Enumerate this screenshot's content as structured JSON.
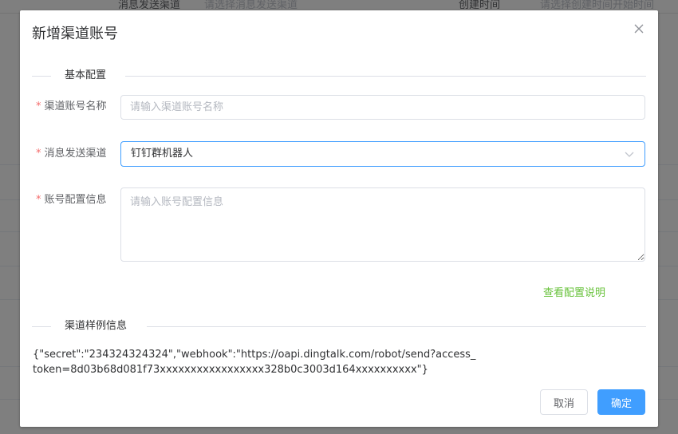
{
  "background": {
    "field1_label": "消息发送渠道",
    "field1_placeholder": "请选择消息发送渠道",
    "field2_label": "创建时间",
    "field2_placeholder": "请选择创建时间开始时间"
  },
  "dialog": {
    "title": "新增渠道账号",
    "close_icon": "close-icon",
    "section_basic": "基本配置",
    "section_sample": "渠道样例信息",
    "fields": {
      "account_name": {
        "label": "渠道账号名称",
        "placeholder": "请输入渠道账号名称",
        "value": ""
      },
      "channel": {
        "label": "消息发送渠道",
        "value": "钉钉群机器人"
      },
      "account_config": {
        "label": "账号配置信息",
        "placeholder": "请输入账号配置信息",
        "value": ""
      }
    },
    "required_mark": "*",
    "view_config_link": "查看配置说明",
    "sample_text": "{\"secret\":\"234324324324\",\"webhook\":\"https://oapi.dingtalk.com/robot/send?access_token=8d03b68d081f73xxxxxxxxxxxxxxxxx328b0c3003d164xxxxxxxxxx\"}",
    "buttons": {
      "cancel": "取消",
      "confirm": "确定"
    }
  },
  "colors": {
    "primary": "#409eff",
    "success_link": "#67c23a",
    "required": "#f56c6c",
    "mask": "rgba(0,0,0,0.5)"
  }
}
